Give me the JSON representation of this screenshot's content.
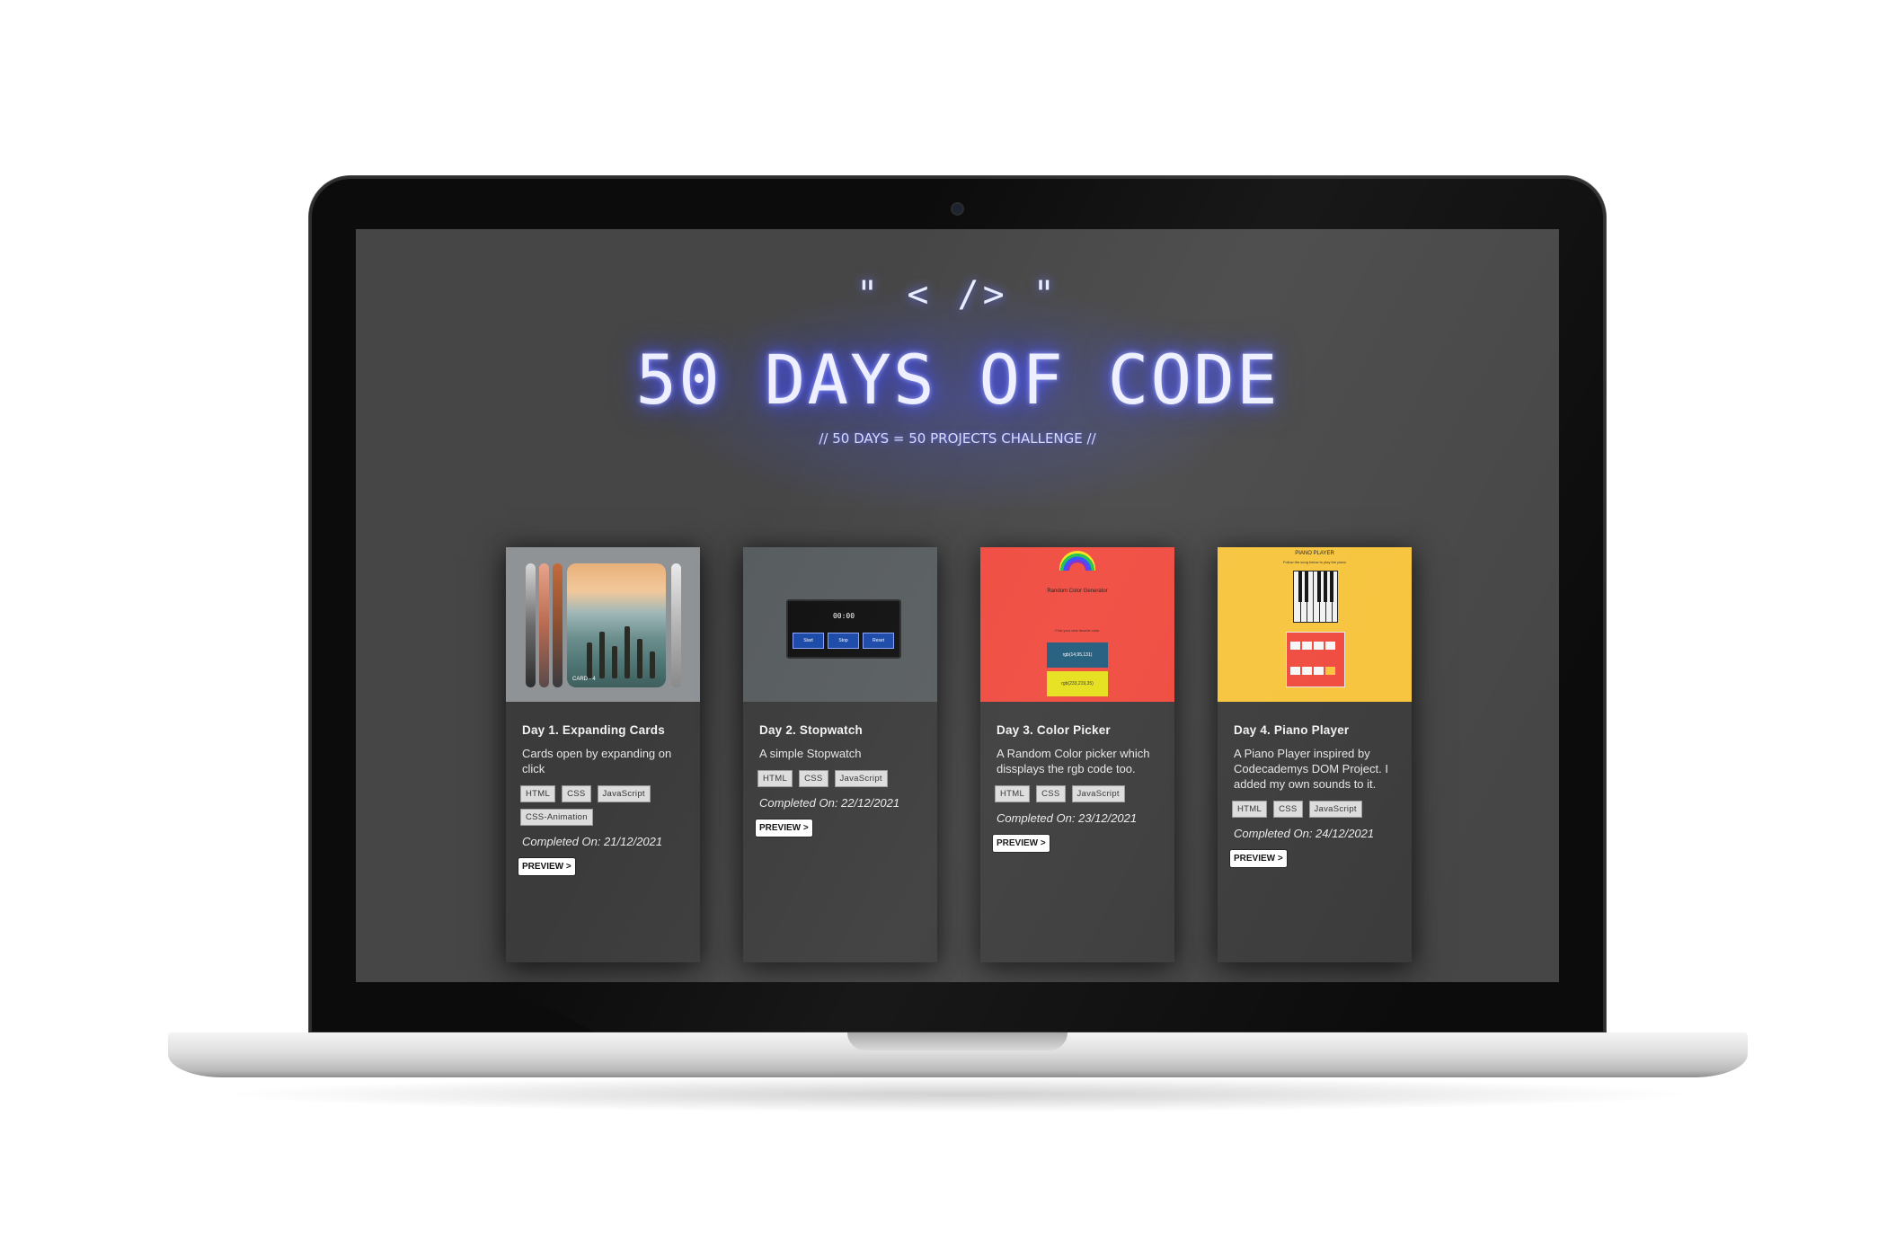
{
  "header": {
    "code_symbol": "\" < /> \"",
    "title": "50 DAYS OF CODE",
    "subtitle": "// 50 DAYS = 50 PROJECTS CHALLENGE //"
  },
  "cards": [
    {
      "title": "Day 1. Expanding Cards",
      "description": "Cards open by expanding on click",
      "tags": [
        "HTML",
        "CSS",
        "JavaScript",
        "CSS-Animation"
      ],
      "completed": "Completed On: 21/12/2021",
      "preview_label": "PREVIEW >",
      "thumb": {
        "caption": "CARD - 4"
      }
    },
    {
      "title": "Day 2. Stopwatch",
      "description": "A simple Stopwatch",
      "tags": [
        "HTML",
        "CSS",
        "JavaScript"
      ],
      "completed": "Completed On: 22/12/2021",
      "preview_label": "PREVIEW >",
      "thumb": {
        "time": "00:00",
        "buttons": [
          "Start",
          "Stop",
          "Reset"
        ]
      }
    },
    {
      "title": "Day 3. Color Picker",
      "description": "A Random Color picker which dissplays the rgb code too.",
      "tags": [
        "HTML",
        "CSS",
        "JavaScript"
      ],
      "completed": "Completed On: 23/12/2021",
      "preview_label": "PREVIEW >",
      "thumb": {
        "heading": "Random Color Generator",
        "hint": "Find your new favorite color",
        "value1": "rgb(14,95,131)",
        "value2": "rgb(233,219,35)"
      }
    },
    {
      "title": "Day 4. Piano Player",
      "description": "A Piano Player inspired by Codecademys DOM Project. I added my own sounds to it.",
      "tags": [
        "HTML",
        "CSS",
        "JavaScript"
      ],
      "completed": "Completed On: 24/12/2021",
      "preview_label": "PREVIEW >",
      "thumb": {
        "heading": "PIANO PLAYER",
        "hint": "Follow the song below to play the piano"
      }
    }
  ],
  "colors": {
    "screen_bg": "#464646",
    "card_bg": "#3b3b3b",
    "neon_accent": "#4a55ff",
    "thumb_color_picker": "#f04a3e",
    "thumb_piano": "#f7c43c"
  }
}
